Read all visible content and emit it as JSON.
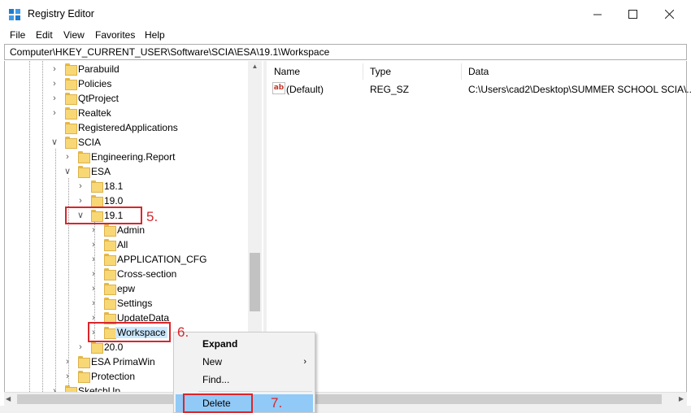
{
  "window": {
    "title": "Registry Editor",
    "icon": "registry-editor-icon",
    "controls": [
      "minimize-icon",
      "maximize-icon",
      "close-icon"
    ]
  },
  "menu": [
    "File",
    "Edit",
    "View",
    "Favorites",
    "Help"
  ],
  "address": "Computer\\HKEY_CURRENT_USER\\Software\\SCIA\\ESA\\19.1\\Workspace",
  "tree": {
    "parabuild": "Parabuild",
    "policies": "Policies",
    "qtproject": "QtProject",
    "realtek": "Realtek",
    "registered_apps": "RegisteredApplications",
    "scia": "SCIA",
    "engineering_report": "Engineering.Report",
    "esa": "ESA",
    "v181": "18.1",
    "v190": "19.0",
    "v191": "19.1",
    "admin": "Admin",
    "all": "All",
    "application_cfg": "APPLICATION_CFG",
    "cross_section": "Cross-section",
    "epw": "epw",
    "settings": "Settings",
    "updatedata": "UpdateData",
    "workspace": "Workspace",
    "v200": "20.0",
    "esa_primawin": "ESA PrimaWin",
    "protection": "Protection",
    "sketchup": "SketchUp"
  },
  "values": {
    "headers": {
      "name": "Name",
      "type": "Type",
      "data": "Data"
    },
    "rows": [
      {
        "name": "(Default)",
        "type": "REG_SZ",
        "data": "C:\\Users\\cad2\\Desktop\\SUMMER SCHOOL SCIA\\..."
      }
    ]
  },
  "context_menu": {
    "expand": "Expand",
    "new": "New",
    "find": "Find...",
    "delete": "Delete"
  },
  "annotations": {
    "step5": "5.",
    "step6": "6.",
    "step7": "7."
  },
  "colors": {
    "selection": "#cce8ff",
    "menu_highlight": "#91c9f7",
    "annotation_red": "#d9262b",
    "folder": "#f8d775"
  }
}
